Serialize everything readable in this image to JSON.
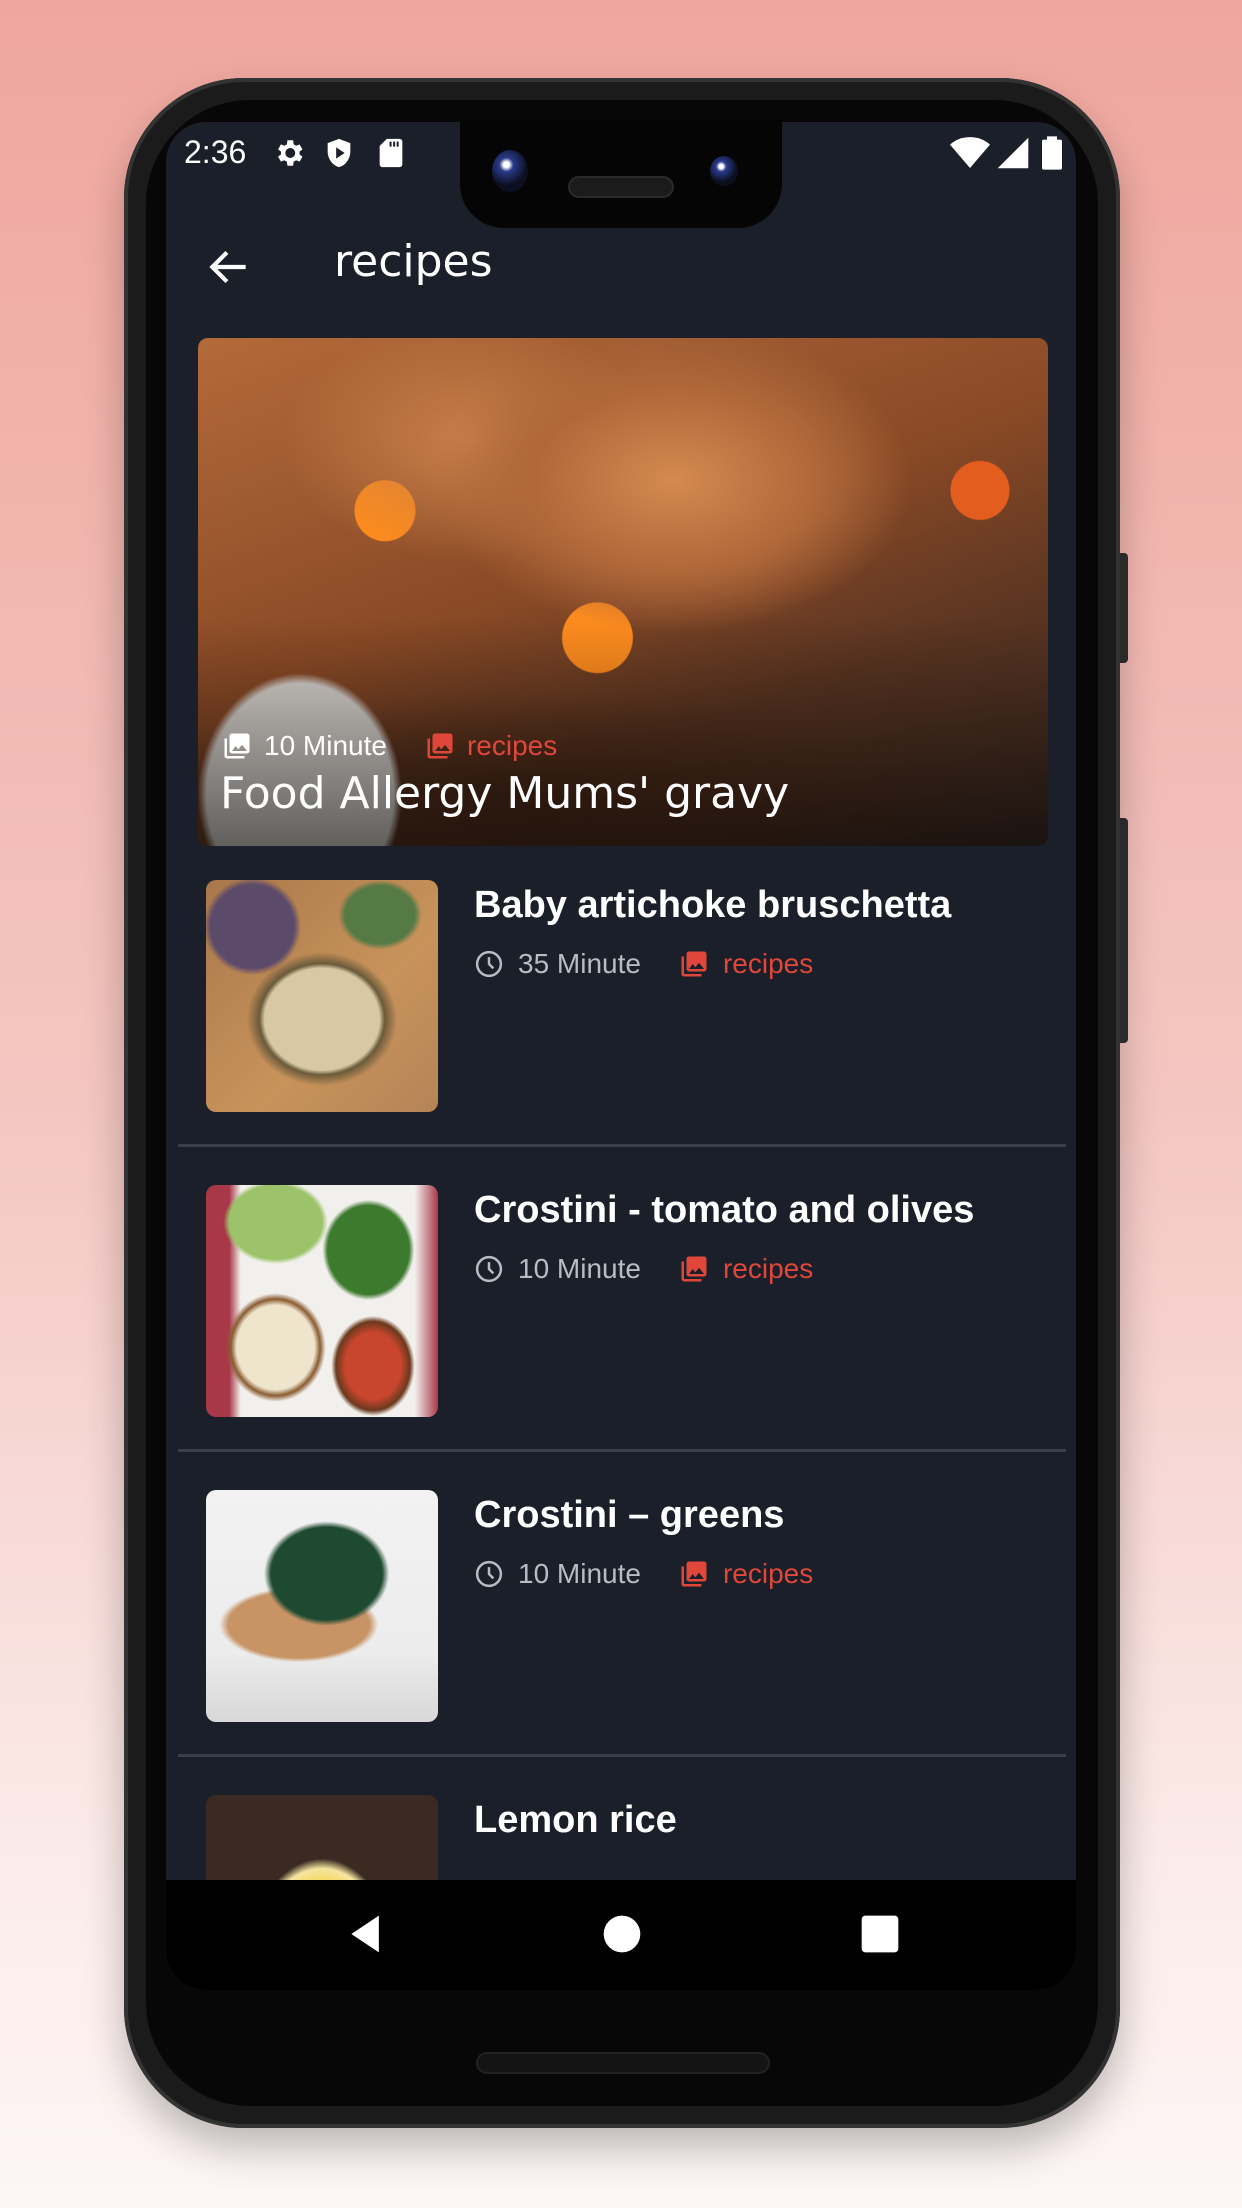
{
  "status_bar": {
    "time": "2:36",
    "left_icons": [
      "gear-icon",
      "shield-play-icon",
      "sd-card-icon"
    ],
    "right_icons": [
      "wifi-icon",
      "cellular-signal-icon",
      "battery-icon"
    ]
  },
  "app_bar": {
    "back_icon": "arrow-left-icon",
    "title": "recipes"
  },
  "featured": {
    "time": "10 Minute",
    "time_icon": "photo-library-icon",
    "category": "recipes",
    "category_icon": "photo-library-icon",
    "title": "Food Allergy Mums' gravy"
  },
  "recipes": [
    {
      "title": "Baby artichoke bruschetta",
      "time": "35 Minute",
      "time_icon": "clock-icon",
      "category": "recipes",
      "category_icon": "photo-library-icon"
    },
    {
      "title": "Crostini - tomato and olives",
      "time": "10 Minute",
      "time_icon": "clock-icon",
      "category": "recipes",
      "category_icon": "photo-library-icon"
    },
    {
      "title": "Crostini – greens",
      "time": "10 Minute",
      "time_icon": "clock-icon",
      "category": "recipes",
      "category_icon": "photo-library-icon"
    },
    {
      "title": "Lemon rice"
    }
  ],
  "nav_bar": {
    "back": "triangle-back-icon",
    "home": "circle-home-icon",
    "recents": "square-recents-icon"
  },
  "colors": {
    "background": "#1a1f29",
    "accent": "#e0473a",
    "divider": "#3a404b",
    "meta_text": "#b9bcc2"
  }
}
